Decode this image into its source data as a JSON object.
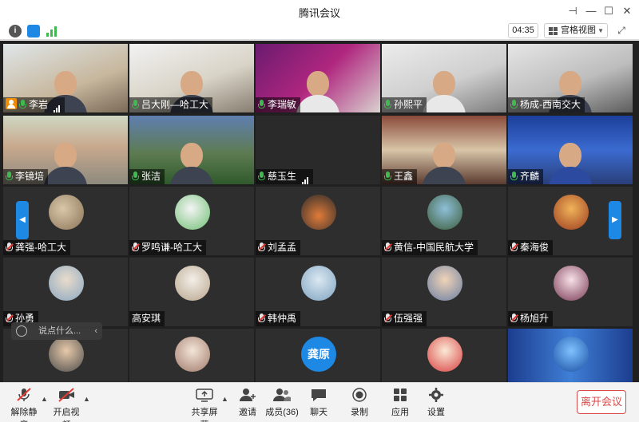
{
  "window": {
    "title": "腾讯会议"
  },
  "toolbar": {
    "timer": "04:35",
    "view_mode": "宫格视图"
  },
  "participants": [
    {
      "name": "李岩",
      "host": true,
      "signal": true
    },
    {
      "name": "吕大刚—哈工大"
    },
    {
      "name": "李瑞敏"
    },
    {
      "name": "孙熙平"
    },
    {
      "name": "杨成-西南交大"
    },
    {
      "name": "李镜培"
    },
    {
      "name": "张洁"
    },
    {
      "name": "慈玉生",
      "signal": true
    },
    {
      "name": "王鑫"
    },
    {
      "name": "齐麟"
    },
    {
      "name": "龚强-哈工大",
      "muted": true
    },
    {
      "name": "罗鸣谦-哈工大",
      "muted": true
    },
    {
      "name": "刘孟孟",
      "muted": true
    },
    {
      "name": "黄信-中国民航大学",
      "muted": true
    },
    {
      "name": "秦海俊",
      "muted": true
    },
    {
      "name": "孙勇",
      "muted": true
    },
    {
      "name": "高安琪"
    },
    {
      "name": "韩仲禹",
      "muted": true
    },
    {
      "name": "伍强强",
      "muted": true
    },
    {
      "name": "杨旭升",
      "muted": true
    },
    {
      "name": ""
    },
    {
      "name": ""
    },
    {
      "name": "",
      "avatar_text": "龚原"
    },
    {
      "name": ""
    },
    {
      "name": ""
    }
  ],
  "chat": {
    "placeholder": "说点什么..."
  },
  "bottom": {
    "unmute": "解除静音",
    "start_video": "开启视频",
    "share_screen": "共享屏幕",
    "invite": "邀请",
    "members": "成员(36)",
    "chat": "聊天",
    "record": "录制",
    "apps": "应用",
    "settings": "设置",
    "end_meeting": "离开会议"
  },
  "colors": {
    "accent": "#1e88e5",
    "mic_on": "#3fb950",
    "muted_slash": "#e53935",
    "end_button": "#d94b4b",
    "host_badge": "#f08c00"
  }
}
